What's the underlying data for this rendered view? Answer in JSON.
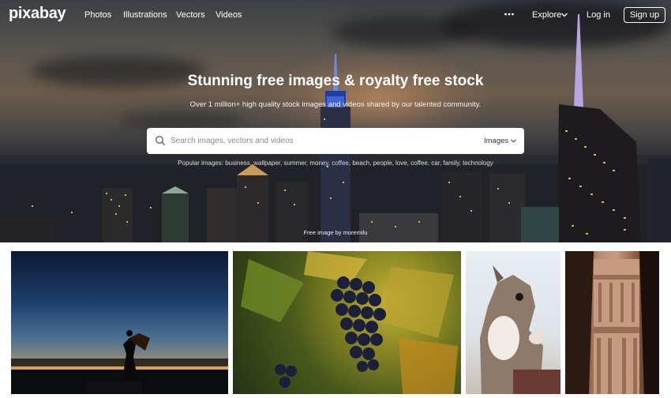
{
  "nav": {
    "logo": "pixabay",
    "links": [
      "Photos",
      "Illustrations",
      "Vectors",
      "Videos"
    ],
    "more_icon": "more-dots-icon",
    "explore": "Explore",
    "login": "Log in",
    "signup": "Sign up"
  },
  "hero": {
    "title": "Stunning free images & royalty free stock",
    "subtitle": "Over 1 million+ high quality stock images and videos shared by our talented community.",
    "search": {
      "placeholder": "Search images, vectors and videos",
      "type": "Images"
    },
    "popular": "Popular images: business, wallpaper, summer, money, coffee, beach, people, love, coffee, car, family, technology",
    "credit": "Free image by moremilu"
  },
  "gallery": [
    {
      "name": "silhouette-dancer-sunset"
    },
    {
      "name": "grapes-on-vine"
    },
    {
      "name": "squirrel"
    },
    {
      "name": "petra-treasury"
    }
  ]
}
